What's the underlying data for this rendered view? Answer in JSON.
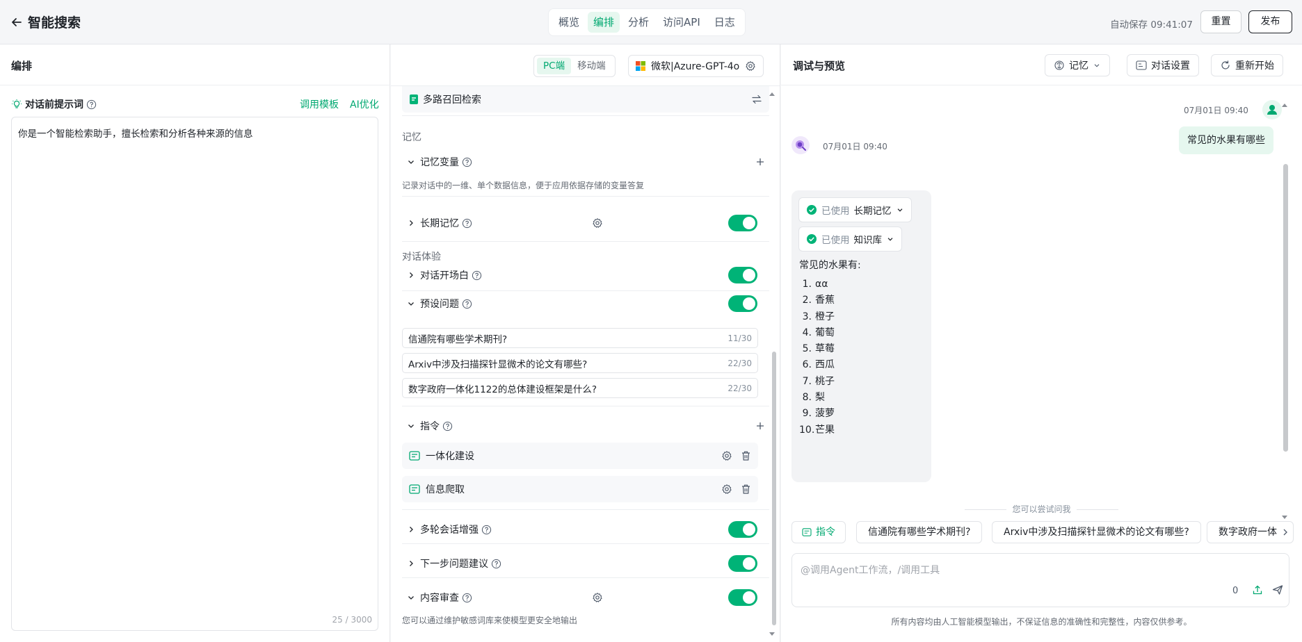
{
  "app": {
    "title": "智能搜索"
  },
  "nav": {
    "tabs": [
      "概览",
      "编排",
      "分析",
      "访问API",
      "日志"
    ],
    "active": "编排"
  },
  "topbar": {
    "autosave": "自动保存 09:41:07",
    "reset_label": "重置",
    "publish_label": "发布"
  },
  "edit": {
    "title": "编排",
    "platforms": [
      "PC端",
      "移动端"
    ],
    "active_platform": "PC端",
    "model": "微软|Azure-GPT-4o",
    "prompt_label": "对话前提示词",
    "template_link": "调用模板",
    "ai_optimize_link": "AI优化",
    "prompt_text": "你是一个智能检索助手，擅长检索和分析各种来源的信息",
    "prompt_counter": "25 / 3000"
  },
  "config": {
    "multi_recall": "多路召回检索",
    "memory_section": "记忆",
    "memory_vars": "记忆变量",
    "memory_vars_desc": "记录对话中的一维、单个数据信息，便于应用依据存储的变量答复",
    "long_memory": "长期记忆",
    "experience_section": "对话体验",
    "opening": "对话开场白",
    "preset_questions": "预设问题",
    "presets": [
      {
        "text": "信通院有哪些学术期刊?",
        "count": "11/30"
      },
      {
        "text": "Arxiv中涉及扫描探针显微术的论文有哪些?",
        "count": "22/30"
      },
      {
        "text": "数字政府一体化1122的总体建设框架是什么?",
        "count": "22/30"
      }
    ],
    "commands": "指令",
    "command_items": [
      "一体化建设",
      "信息爬取"
    ],
    "multi_turn": "多轮会话增强",
    "next_suggest": "下一步问题建议",
    "content_review": "内容审查",
    "content_review_desc": "您可以通过维护敏感词库来使模型更安全地输出",
    "toggles_on": true
  },
  "debug": {
    "title": "调试与预览",
    "memory_btn": "记忆",
    "settings_btn": "对话设置",
    "restart_btn": "重新开始",
    "user_time": "07月01日 09:40",
    "user_message": "常见的水果有哪些",
    "bot_time": "07月01日 09:40",
    "used_prefix": "已使用",
    "used_items": [
      "长期记忆",
      "知识库"
    ],
    "answer_intro": "常见的水果有:",
    "fruits": [
      "αα",
      "香蕉",
      "橙子",
      "葡萄",
      "草莓",
      "西瓜",
      "桃子",
      "梨",
      "菠萝",
      "芒果"
    ],
    "try_label": "您可以尝试问我",
    "suggest_cmd": "指令",
    "suggestions": [
      "信通院有哪些学术期刊?",
      "Arxiv中涉及扫描探针显微术的论文有哪些?",
      "数字政府一体"
    ],
    "input_placeholder": "@调用Agent工作流，/调用工具",
    "input_count": "0",
    "disclaimer": "所有内容均由人工智能模型输出，不保证信息的准确性和完整性，内容仅供参考。"
  },
  "colors": {
    "accent": "#00a870",
    "toggle": "#00b377",
    "bubble": "#e6f7ef"
  }
}
